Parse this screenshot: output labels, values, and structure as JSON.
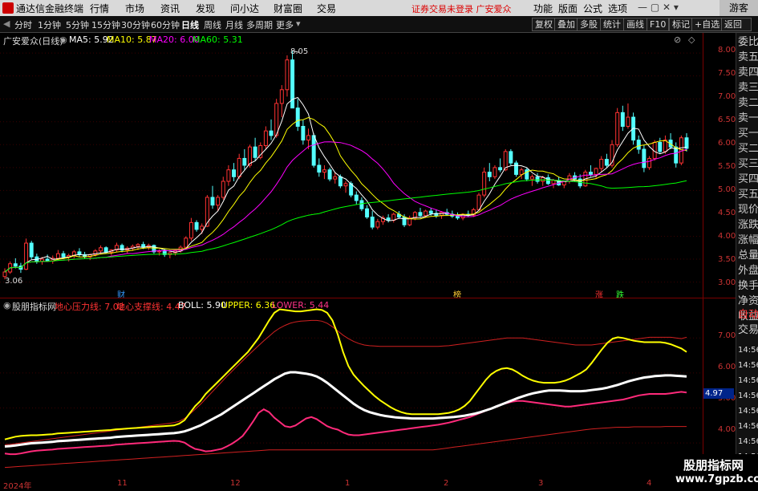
{
  "menubar": {
    "app_title": "通达信金融终端",
    "items": [
      "行情",
      "市场",
      "资讯",
      "发现",
      "问小达",
      "财富圈",
      "交易"
    ],
    "notice": "证券交易未登录  广安爱众",
    "right_items": [
      "功能",
      "版面",
      "公式",
      "选项"
    ],
    "guest": "游客"
  },
  "periods": {
    "items": [
      "分时",
      "1分钟",
      "5分钟",
      "15分钟",
      "30分钟",
      "60分钟",
      "日线",
      "周线",
      "月线",
      "多周期",
      "更多"
    ],
    "active": "日线"
  },
  "toolbar": {
    "right_buttons": [
      "复权",
      "叠加",
      "多股",
      "统计",
      "画线",
      "F10",
      "标记",
      "+自选",
      "返回"
    ]
  },
  "main": {
    "title": "广安爱众(日线)",
    "ma_legend": [
      {
        "label": "MA5: 5.92",
        "color": "#ffffff"
      },
      {
        "label": "MA10: 5.87",
        "color": "#ffff00"
      },
      {
        "label": "MA20: 6.00",
        "color": "#ff00ff"
      },
      {
        "label": "MA60: 5.31",
        "color": "#00ff00"
      }
    ],
    "high_label": "8.05",
    "low_label": "3.06",
    "y_labels": [
      "8.00",
      "7.50",
      "7.00",
      "6.50",
      "6.00",
      "5.50",
      "5.00",
      "4.50",
      "4.00",
      "3.50",
      "3.00"
    ],
    "y_min": 2.8,
    "y_max": 8.3,
    "markers": [
      {
        "text": "财",
        "color": "#3399ff"
      },
      {
        "text": "榜",
        "color": "#ffcc33"
      },
      {
        "text": "涨",
        "color": "#ff3333"
      },
      {
        "text": "跌",
        "color": "#33ff33"
      }
    ]
  },
  "indicator": {
    "title": "股朋指标网",
    "legend": [
      {
        "label": "地心压力线: 7.02",
        "color": "#ff3333"
      },
      {
        "label": "地心支撑线: 4.47",
        "color": "#ff3333"
      },
      {
        "label": "BOLL: 5.90",
        "color": "#ffffff"
      },
      {
        "label": "UPPER: 6.36",
        "color": "#ffff00"
      },
      {
        "label": "LOWER: 5.44",
        "color": "#ff3388"
      }
    ],
    "y_labels": [
      "7.00",
      "6.00",
      "5.00",
      "4.00"
    ],
    "y_min": 3.2,
    "y_max": 7.9,
    "current_value": "4.97"
  },
  "sidebar": {
    "items": [
      "委比",
      "卖五",
      "卖四",
      "卖三",
      "卖二",
      "卖一",
      "买一",
      "买二",
      "买三",
      "买四",
      "买五",
      "现价",
      "涨跌",
      "涨幅",
      "总量",
      "外盘",
      "换手",
      "净资",
      "收益",
      "自动",
      "交易",
      "14:56",
      "14:56",
      "14:56",
      "14:56",
      "14:56",
      "14:56",
      "14:56",
      "14:56",
      "14:56"
    ]
  },
  "x_axis": {
    "labels": [
      "2024年",
      "11",
      "12",
      "1",
      "2",
      "3",
      "4"
    ]
  },
  "watermark": {
    "line1": "股朋指标网",
    "line2": "www.7gpzb.com"
  },
  "chart_data": {
    "type": "candlestick",
    "ma_series_names": [
      "MA5",
      "MA10",
      "MA20",
      "MA60"
    ],
    "high": 8.05,
    "low": 3.06,
    "ohlc": [
      [
        3.12,
        3.3,
        3.06,
        3.22
      ],
      [
        3.22,
        3.45,
        3.18,
        3.4
      ],
      [
        3.4,
        3.52,
        3.3,
        3.35
      ],
      [
        3.35,
        3.42,
        3.2,
        3.28
      ],
      [
        3.28,
        3.95,
        3.26,
        3.85
      ],
      [
        3.85,
        3.9,
        3.5,
        3.55
      ],
      [
        3.55,
        3.62,
        3.4,
        3.45
      ],
      [
        3.45,
        3.55,
        3.38,
        3.5
      ],
      [
        3.5,
        3.6,
        3.44,
        3.46
      ],
      [
        3.46,
        3.58,
        3.4,
        3.52
      ],
      [
        3.52,
        3.7,
        3.48,
        3.62
      ],
      [
        3.62,
        3.68,
        3.5,
        3.55
      ],
      [
        3.55,
        3.62,
        3.45,
        3.58
      ],
      [
        3.58,
        3.7,
        3.52,
        3.66
      ],
      [
        3.66,
        3.74,
        3.55,
        3.6
      ],
      [
        3.6,
        3.66,
        3.5,
        3.55
      ],
      [
        3.55,
        3.62,
        3.48,
        3.6
      ],
      [
        3.6,
        3.72,
        3.56,
        3.68
      ],
      [
        3.68,
        3.8,
        3.6,
        3.75
      ],
      [
        3.75,
        3.78,
        3.62,
        3.65
      ],
      [
        3.65,
        3.72,
        3.58,
        3.7
      ],
      [
        3.7,
        3.86,
        3.65,
        3.8
      ],
      [
        3.8,
        3.84,
        3.65,
        3.7
      ],
      [
        3.7,
        3.78,
        3.62,
        3.74
      ],
      [
        3.74,
        3.82,
        3.68,
        3.78
      ],
      [
        3.78,
        3.85,
        3.7,
        3.82
      ],
      [
        3.82,
        3.88,
        3.72,
        3.76
      ],
      [
        3.76,
        3.84,
        3.7,
        3.8
      ],
      [
        3.8,
        3.82,
        3.62,
        3.66
      ],
      [
        3.66,
        3.72,
        3.58,
        3.68
      ],
      [
        3.68,
        3.72,
        3.55,
        3.6
      ],
      [
        3.6,
        3.66,
        3.52,
        3.64
      ],
      [
        3.64,
        3.7,
        3.58,
        3.68
      ],
      [
        3.68,
        3.8,
        3.64,
        3.76
      ],
      [
        3.76,
        4.0,
        3.72,
        3.96
      ],
      [
        3.96,
        4.4,
        3.9,
        4.3
      ],
      [
        4.3,
        4.35,
        4.1,
        4.15
      ],
      [
        4.15,
        4.28,
        4.05,
        4.22
      ],
      [
        4.22,
        4.9,
        4.2,
        4.85
      ],
      [
        4.85,
        5.1,
        4.6,
        4.68
      ],
      [
        4.68,
        4.9,
        4.55,
        4.85
      ],
      [
        4.85,
        5.3,
        4.8,
        5.2
      ],
      [
        5.2,
        5.55,
        5.1,
        5.45
      ],
      [
        5.45,
        5.6,
        5.2,
        5.3
      ],
      [
        5.3,
        5.8,
        5.25,
        5.7
      ],
      [
        5.7,
        5.9,
        5.45,
        5.55
      ],
      [
        5.55,
        6.0,
        5.5,
        5.95
      ],
      [
        5.95,
        6.15,
        5.65,
        5.72
      ],
      [
        5.72,
        6.05,
        5.68,
        5.98
      ],
      [
        5.98,
        6.4,
        5.9,
        6.3
      ],
      [
        6.3,
        6.55,
        6.1,
        6.2
      ],
      [
        6.2,
        7.0,
        6.15,
        6.9
      ],
      [
        6.9,
        7.3,
        6.6,
        7.2
      ],
      [
        7.2,
        7.95,
        7.05,
        7.85
      ],
      [
        7.85,
        8.05,
        7.6,
        6.8
      ],
      [
        6.8,
        7.0,
        6.3,
        6.4
      ],
      [
        6.4,
        6.55,
        6.0,
        6.1
      ],
      [
        6.1,
        6.35,
        5.9,
        6.2
      ],
      [
        6.2,
        6.25,
        5.5,
        5.55
      ],
      [
        5.55,
        5.7,
        5.3,
        5.4
      ],
      [
        5.4,
        5.55,
        5.25,
        5.45
      ],
      [
        5.45,
        5.5,
        5.2,
        5.25
      ],
      [
        5.25,
        5.4,
        5.15,
        5.3
      ],
      [
        5.3,
        5.35,
        5.05,
        5.1
      ],
      [
        5.1,
        5.2,
        4.95,
        5.15
      ],
      [
        5.15,
        5.2,
        4.85,
        4.9
      ],
      [
        4.9,
        4.98,
        4.7,
        4.78
      ],
      [
        4.78,
        4.85,
        4.55,
        4.6
      ],
      [
        4.6,
        4.68,
        4.38,
        4.42
      ],
      [
        4.42,
        4.55,
        4.15,
        4.2
      ],
      [
        4.2,
        4.38,
        4.15,
        4.32
      ],
      [
        4.32,
        4.45,
        4.25,
        4.4
      ],
      [
        4.4,
        4.48,
        4.3,
        4.35
      ],
      [
        4.35,
        4.52,
        4.3,
        4.48
      ],
      [
        4.48,
        4.55,
        4.38,
        4.42
      ],
      [
        4.42,
        4.48,
        4.2,
        4.25
      ],
      [
        4.25,
        4.45,
        4.22,
        4.4
      ],
      [
        4.4,
        4.55,
        4.35,
        4.52
      ],
      [
        4.52,
        4.62,
        4.42,
        4.45
      ],
      [
        4.45,
        4.58,
        4.4,
        4.55
      ],
      [
        4.55,
        4.62,
        4.45,
        4.5
      ],
      [
        4.5,
        4.58,
        4.4,
        4.45
      ],
      [
        4.45,
        4.55,
        4.38,
        4.52
      ],
      [
        4.52,
        4.6,
        4.45,
        4.48
      ],
      [
        4.48,
        4.56,
        4.4,
        4.44
      ],
      [
        4.44,
        4.52,
        4.36,
        4.4
      ],
      [
        4.4,
        4.5,
        4.35,
        4.48
      ],
      [
        4.48,
        4.56,
        4.42,
        4.46
      ],
      [
        4.46,
        4.62,
        4.42,
        4.58
      ],
      [
        4.58,
        4.95,
        4.55,
        4.9
      ],
      [
        4.9,
        5.5,
        4.85,
        5.4
      ],
      [
        5.4,
        5.6,
        5.2,
        5.3
      ],
      [
        5.3,
        5.55,
        5.25,
        5.5
      ],
      [
        5.5,
        5.7,
        5.4,
        5.45
      ],
      [
        5.45,
        5.9,
        5.42,
        5.85
      ],
      [
        5.85,
        5.9,
        5.55,
        5.6
      ],
      [
        5.6,
        5.65,
        5.3,
        5.35
      ],
      [
        5.35,
        5.5,
        5.25,
        5.45
      ],
      [
        5.45,
        5.5,
        5.2,
        5.25
      ],
      [
        5.25,
        5.35,
        5.1,
        5.3
      ],
      [
        5.3,
        5.38,
        5.15,
        5.2
      ],
      [
        5.2,
        5.32,
        5.1,
        5.28
      ],
      [
        5.28,
        5.35,
        5.12,
        5.15
      ],
      [
        5.15,
        5.25,
        5.05,
        5.22
      ],
      [
        5.22,
        5.3,
        5.1,
        5.12
      ],
      [
        5.12,
        5.22,
        5.05,
        5.2
      ],
      [
        5.2,
        5.38,
        5.15,
        5.32
      ],
      [
        5.32,
        5.4,
        5.2,
        5.25
      ],
      [
        5.25,
        5.35,
        5.05,
        5.1
      ],
      [
        5.1,
        5.45,
        5.08,
        5.4
      ],
      [
        5.4,
        5.55,
        5.3,
        5.35
      ],
      [
        5.35,
        5.5,
        5.25,
        5.48
      ],
      [
        5.48,
        5.75,
        5.4,
        5.68
      ],
      [
        5.68,
        5.8,
        5.5,
        5.55
      ],
      [
        5.55,
        6.1,
        5.5,
        6.0
      ],
      [
        6.0,
        6.8,
        5.95,
        6.7
      ],
      [
        6.7,
        6.85,
        6.3,
        6.4
      ],
      [
        6.4,
        6.9,
        6.35,
        6.6
      ],
      [
        6.6,
        6.7,
        6.0,
        6.1
      ],
      [
        6.1,
        6.2,
        5.8,
        5.9
      ],
      [
        5.9,
        6.0,
        5.4,
        5.5
      ],
      [
        5.5,
        5.75,
        5.45,
        5.7
      ],
      [
        5.7,
        6.1,
        5.65,
        6.05
      ],
      [
        6.05,
        6.15,
        5.8,
        5.85
      ],
      [
        5.85,
        6.2,
        5.8,
        6.1
      ],
      [
        6.1,
        6.25,
        5.9,
        5.95
      ],
      [
        5.95,
        6.05,
        5.5,
        5.6
      ],
      [
        5.6,
        6.2,
        5.55,
        6.15
      ],
      [
        6.15,
        6.25,
        5.85,
        5.92
      ]
    ],
    "boll": [
      3.9,
      3.91,
      3.93,
      3.95,
      3.97,
      3.99,
      4.0,
      4.01,
      4.02,
      4.03,
      4.05,
      4.06,
      4.07,
      4.08,
      4.09,
      4.1,
      4.11,
      4.12,
      4.13,
      4.14,
      4.15,
      4.17,
      4.18,
      4.19,
      4.2,
      4.21,
      4.22,
      4.23,
      4.24,
      4.25,
      4.26,
      4.27,
      4.28,
      4.3,
      4.33,
      4.38,
      4.44,
      4.5,
      4.58,
      4.66,
      4.74,
      4.82,
      4.92,
      5.02,
      5.12,
      5.22,
      5.32,
      5.42,
      5.52,
      5.62,
      5.72,
      5.82,
      5.9,
      5.98,
      6.02,
      6.02,
      6.0,
      5.98,
      5.95,
      5.9,
      5.82,
      5.72,
      5.6,
      5.48,
      5.36,
      5.24,
      5.12,
      5.02,
      4.94,
      4.88,
      4.84,
      4.8,
      4.77,
      4.75,
      4.73,
      4.72,
      4.71,
      4.7,
      4.7,
      4.7,
      4.7,
      4.7,
      4.71,
      4.72,
      4.73,
      4.74,
      4.76,
      4.78,
      4.81,
      4.84,
      4.88,
      4.93,
      4.98,
      5.04,
      5.1,
      5.16,
      5.22,
      5.28,
      5.33,
      5.38,
      5.42,
      5.45,
      5.48,
      5.5,
      5.5,
      5.5,
      5.49,
      5.48,
      5.48,
      5.48,
      5.49,
      5.51,
      5.53,
      5.55,
      5.58,
      5.62,
      5.66,
      5.71,
      5.76,
      5.8,
      5.84,
      5.87,
      5.89,
      5.91,
      5.92,
      5.93,
      5.93,
      5.92,
      5.91,
      5.9
    ],
    "upper": [
      4.1,
      4.14,
      4.18,
      4.2,
      4.21,
      4.22,
      4.22,
      4.23,
      4.24,
      4.25,
      4.27,
      4.28,
      4.29,
      4.3,
      4.31,
      4.32,
      4.33,
      4.34,
      4.35,
      4.36,
      4.37,
      4.39,
      4.4,
      4.41,
      4.42,
      4.43,
      4.44,
      4.45,
      4.46,
      4.47,
      4.48,
      4.49,
      4.5,
      4.55,
      4.65,
      4.85,
      5.05,
      5.2,
      5.4,
      5.55,
      5.7,
      5.85,
      6.0,
      6.15,
      6.3,
      6.45,
      6.6,
      6.8,
      7.0,
      7.25,
      7.5,
      7.72,
      7.82,
      7.8,
      7.78,
      7.76,
      7.76,
      7.78,
      7.8,
      7.82,
      7.8,
      7.72,
      7.5,
      7.1,
      6.6,
      6.2,
      5.95,
      5.78,
      5.62,
      5.48,
      5.34,
      5.22,
      5.12,
      5.02,
      4.94,
      4.88,
      4.84,
      4.82,
      4.82,
      4.82,
      4.82,
      4.82,
      4.82,
      4.84,
      4.86,
      4.9,
      4.96,
      5.06,
      5.2,
      5.4,
      5.6,
      5.8,
      5.96,
      6.06,
      6.12,
      6.14,
      6.1,
      6.02,
      5.92,
      5.84,
      5.78,
      5.74,
      5.72,
      5.72,
      5.72,
      5.74,
      5.78,
      5.84,
      5.92,
      6.0,
      6.1,
      6.28,
      6.48,
      6.68,
      6.86,
      6.98,
      7.02,
      7.0,
      6.96,
      6.92,
      6.9,
      6.88,
      6.88,
      6.88,
      6.88,
      6.86,
      6.82,
      6.76,
      6.7,
      6.6
    ],
    "lower": [
      3.7,
      3.68,
      3.68,
      3.7,
      3.73,
      3.76,
      3.78,
      3.79,
      3.8,
      3.81,
      3.83,
      3.84,
      3.85,
      3.86,
      3.87,
      3.88,
      3.89,
      3.9,
      3.91,
      3.92,
      3.93,
      3.95,
      3.96,
      3.97,
      3.98,
      3.99,
      4.0,
      4.01,
      4.02,
      4.03,
      4.04,
      4.05,
      4.06,
      4.05,
      4.01,
      3.91,
      3.83,
      3.8,
      3.76,
      3.77,
      3.8,
      3.83,
      3.9,
      3.98,
      4.08,
      4.2,
      4.4,
      4.62,
      4.86,
      4.96,
      4.88,
      4.72,
      4.6,
      4.48,
      4.45,
      4.5,
      4.6,
      4.7,
      4.74,
      4.68,
      4.58,
      4.48,
      4.42,
      4.38,
      4.3,
      4.24,
      4.22,
      4.22,
      4.24,
      4.26,
      4.28,
      4.3,
      4.32,
      4.34,
      4.36,
      4.38,
      4.4,
      4.42,
      4.44,
      4.46,
      4.48,
      4.5,
      4.52,
      4.55,
      4.58,
      4.62,
      4.66,
      4.7,
      4.74,
      4.8,
      4.86,
      4.92,
      4.98,
      5.05,
      5.1,
      5.14,
      5.18,
      5.2,
      5.2,
      5.18,
      5.16,
      5.14,
      5.12,
      5.1,
      5.08,
      5.06,
      5.04,
      5.04,
      5.06,
      5.08,
      5.1,
      5.12,
      5.14,
      5.16,
      5.18,
      5.2,
      5.22,
      5.24,
      5.28,
      5.32,
      5.36,
      5.38,
      5.4,
      5.4,
      5.4,
      5.4,
      5.42,
      5.44,
      5.46,
      5.44
    ],
    "pressure": [
      3.95,
      3.96,
      3.98,
      4.0,
      4.02,
      4.04,
      4.06,
      4.08,
      4.1,
      4.12,
      4.14,
      4.16,
      4.18,
      4.2,
      4.22,
      4.24,
      4.26,
      4.28,
      4.3,
      4.32,
      4.34,
      4.36,
      4.38,
      4.4,
      4.42,
      4.44,
      4.46,
      4.48,
      4.5,
      4.52,
      4.54,
      4.56,
      4.58,
      4.62,
      4.7,
      4.82,
      4.96,
      5.1,
      5.26,
      5.42,
      5.58,
      5.74,
      5.9,
      6.05,
      6.2,
      6.35,
      6.5,
      6.64,
      6.78,
      6.92,
      7.05,
      7.18,
      7.28,
      7.36,
      7.42,
      7.46,
      7.48,
      7.49,
      7.5,
      7.5,
      7.48,
      7.42,
      7.32,
      7.2,
      7.08,
      6.98,
      6.9,
      6.84,
      6.8,
      6.78,
      6.77,
      6.76,
      6.76,
      6.76,
      6.76,
      6.76,
      6.76,
      6.76,
      6.76,
      6.76,
      6.76,
      6.76,
      6.76,
      6.77,
      6.78,
      6.8,
      6.82,
      6.84,
      6.86,
      6.88,
      6.9,
      6.92,
      6.94,
      6.96,
      6.98,
      7.0,
      7.0,
      7.0,
      7.0,
      6.98,
      6.96,
      6.94,
      6.92,
      6.9,
      6.88,
      6.86,
      6.84,
      6.82,
      6.8,
      6.8,
      6.8,
      6.8,
      6.82,
      6.84,
      6.86,
      6.88,
      6.9,
      6.92,
      6.94,
      6.96,
      6.98,
      7.0,
      7.02,
      7.02,
      7.02,
      7.02,
      7.02,
      7.0,
      6.98,
      7.02
    ],
    "support": [
      3.3,
      3.31,
      3.32,
      3.33,
      3.34,
      3.35,
      3.36,
      3.37,
      3.38,
      3.39,
      3.4,
      3.41,
      3.42,
      3.43,
      3.44,
      3.45,
      3.46,
      3.47,
      3.48,
      3.49,
      3.5,
      3.51,
      3.52,
      3.53,
      3.54,
      3.55,
      3.56,
      3.57,
      3.58,
      3.59,
      3.6,
      3.61,
      3.62,
      3.63,
      3.64,
      3.65,
      3.66,
      3.67,
      3.68,
      3.69,
      3.7,
      3.71,
      3.72,
      3.73,
      3.74,
      3.75,
      3.76,
      3.77,
      3.78,
      3.79,
      3.8,
      3.8,
      3.8,
      3.8,
      3.8,
      3.8,
      3.8,
      3.8,
      3.8,
      3.8,
      3.8,
      3.8,
      3.8,
      3.8,
      3.8,
      3.8,
      3.8,
      3.8,
      3.8,
      3.8,
      3.8,
      3.8,
      3.8,
      3.8,
      3.8,
      3.8,
      3.8,
      3.8,
      3.8,
      3.8,
      3.8,
      3.8,
      3.82,
      3.84,
      3.86,
      3.88,
      3.9,
      3.92,
      3.94,
      3.96,
      3.98,
      4.0,
      4.02,
      4.04,
      4.06,
      4.08,
      4.1,
      4.12,
      4.14,
      4.16,
      4.18,
      4.2,
      4.22,
      4.24,
      4.26,
      4.28,
      4.3,
      4.32,
      4.34,
      4.36,
      4.38,
      4.4,
      4.41,
      4.42,
      4.43,
      4.44,
      4.45,
      4.45,
      4.45,
      4.46,
      4.46,
      4.46,
      4.46,
      4.46,
      4.46,
      4.47,
      4.47,
      4.47,
      4.47,
      4.47
    ]
  }
}
